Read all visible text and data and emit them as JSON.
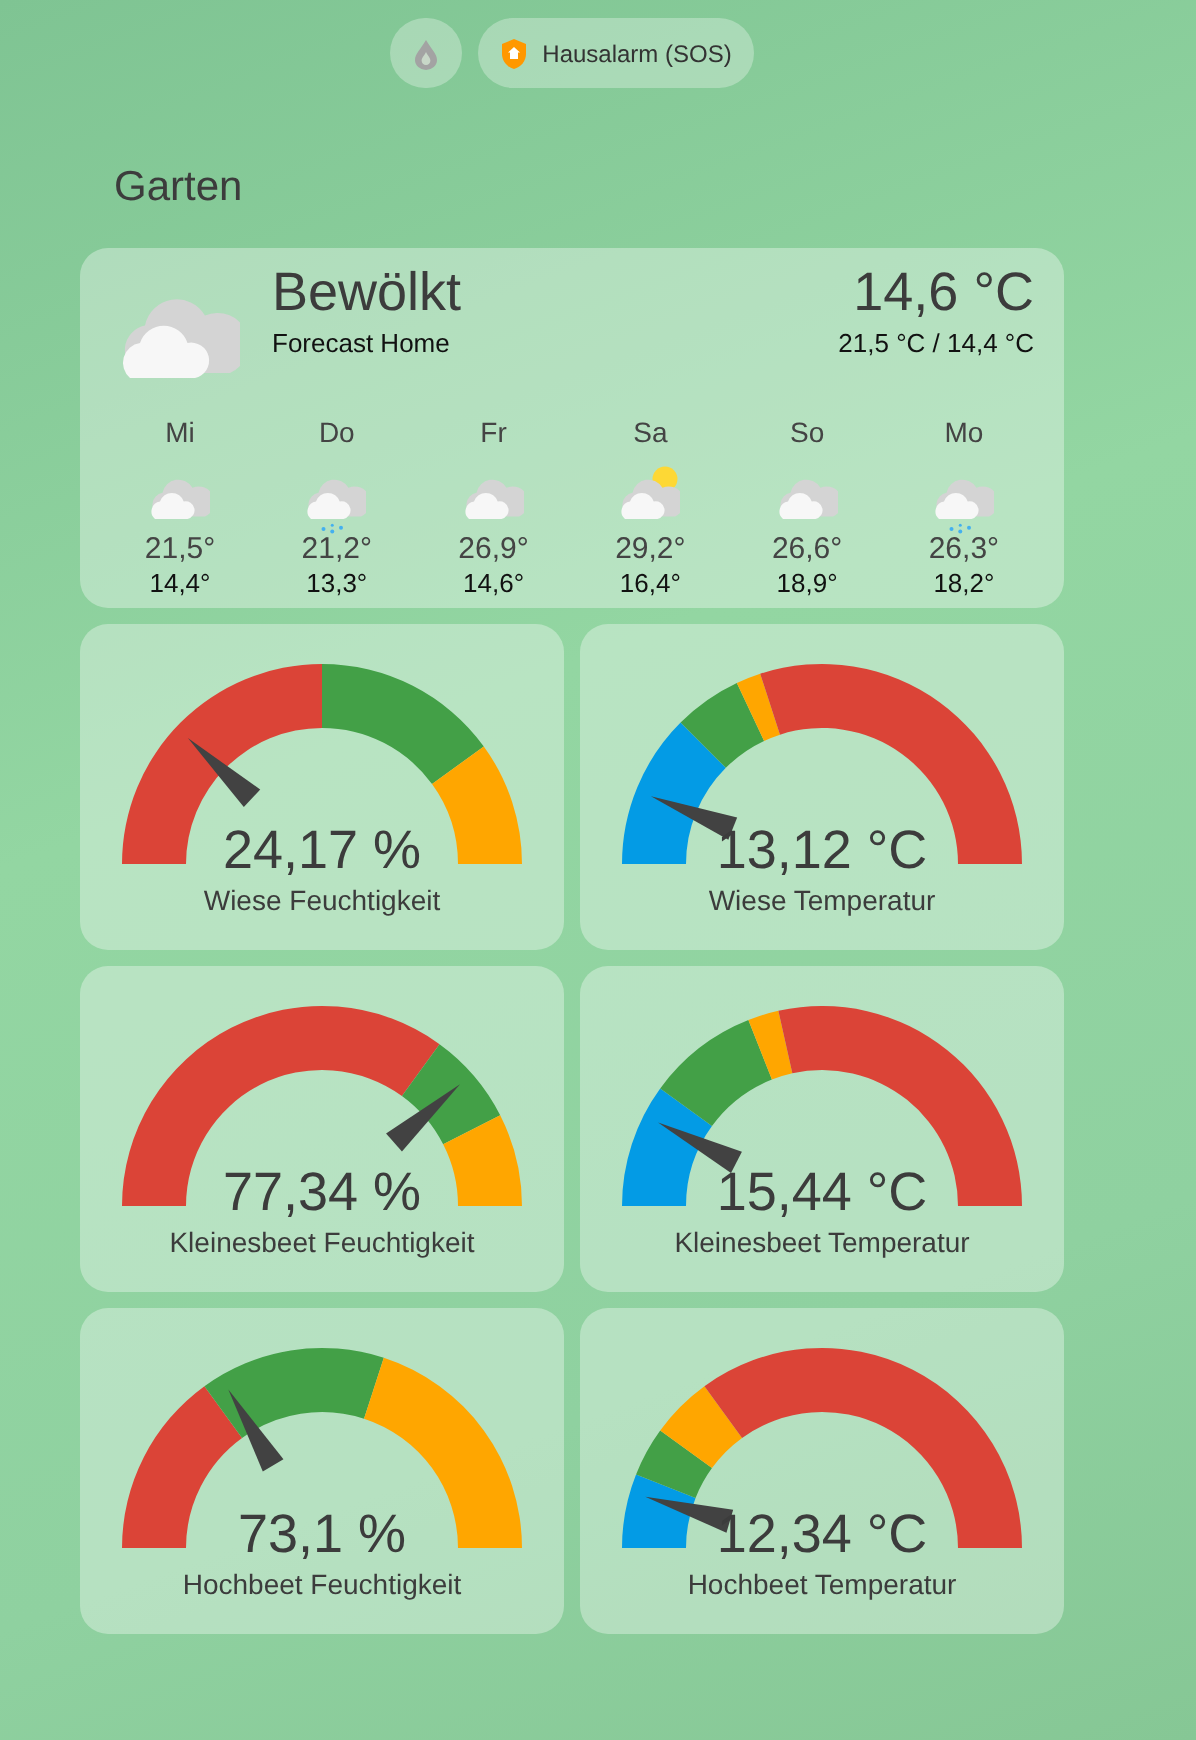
{
  "top_chips": [
    {
      "kind": "icon_only"
    },
    {
      "kind": "alarm",
      "label": "Hausalarm (SOS)"
    }
  ],
  "section_title": "Garten",
  "weather": {
    "condition": "Bewölkt",
    "kind": "cloudy",
    "source": "Forecast Home",
    "temperature": "14,6 °C",
    "high_low": "21,5 °C / 14,4 °C",
    "forecast": [
      {
        "day": "Mi",
        "kind": "cloudy",
        "high": "21,5°",
        "low": "14,4°"
      },
      {
        "day": "Do",
        "kind": "rainy",
        "high": "21,2°",
        "low": "13,3°"
      },
      {
        "day": "Fr",
        "kind": "cloudy",
        "high": "26,9°",
        "low": "14,6°"
      },
      {
        "day": "Sa",
        "kind": "partlycloudy",
        "high": "29,2°",
        "low": "16,4°"
      },
      {
        "day": "So",
        "kind": "cloudy",
        "high": "26,6°",
        "low": "18,9°"
      },
      {
        "day": "Mo",
        "kind": "rainy",
        "high": "26,3°",
        "low": "18,2°"
      }
    ]
  },
  "gauges": [
    {
      "value": "24,17 %",
      "name": "Wiese Feuchtigkeit",
      "segments": [
        {
          "color": "#db4437"
        },
        {
          "color": "#43a047"
        },
        {
          "color": "#ffa600"
        }
      ]
    },
    {
      "value": "13,12 °C",
      "name": "Wiese Temperatur",
      "segments": [
        {
          "color": "#039be5"
        },
        {
          "color": "#43a047"
        },
        {
          "color": "#ffa600"
        },
        {
          "color": "#db4437"
        }
      ]
    },
    {
      "value": "77,34 %",
      "name": "Kleinesbeet Feuchtigkeit",
      "segments": [
        {
          "color": "#db4437"
        },
        {
          "color": "#43a047"
        },
        {
          "color": "#ffa600"
        }
      ]
    },
    {
      "value": "15,44 °C",
      "name": "Kleinesbeet Temperatur",
      "segments": [
        {
          "color": "#039be5"
        },
        {
          "color": "#43a047"
        },
        {
          "color": "#ffa600"
        },
        {
          "color": "#db4437"
        }
      ]
    },
    {
      "value": "73,1 %",
      "name": "Hochbeet Feuchtigkeit",
      "segments": [
        {
          "color": "#db4437"
        },
        {
          "color": "#43a047"
        },
        {
          "color": "#ffa600"
        }
      ]
    },
    {
      "value": "12,34 °C",
      "name": "Hochbeet Temperatur",
      "segments": [
        {
          "color": "#039be5"
        },
        {
          "color": "#43a047"
        },
        {
          "color": "#ffa600"
        },
        {
          "color": "#db4437"
        }
      ]
    }
  ]
}
